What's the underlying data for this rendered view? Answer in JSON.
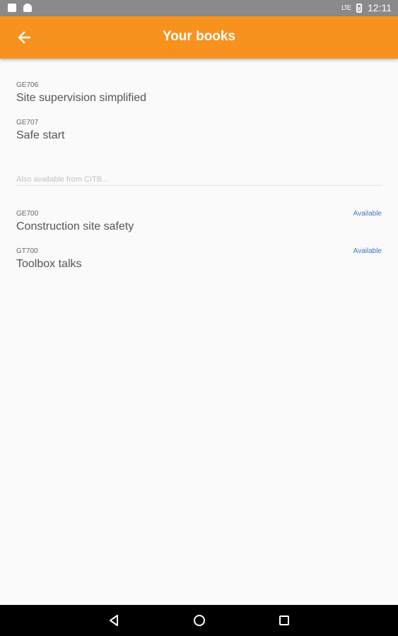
{
  "status_bar": {
    "time": "12:11",
    "network": "LTE",
    "icons": [
      "sd-card-icon",
      "android-icon",
      "signal-icon",
      "battery-icon"
    ]
  },
  "header": {
    "title": "Your books",
    "back_icon": "arrow-left-icon",
    "color": "#f7921e"
  },
  "owned_books": [
    {
      "code": "GE706",
      "name": "Site supervision simplified"
    },
    {
      "code": "GE707",
      "name": "Safe start"
    }
  ],
  "section_hint": "Also available from CITB...",
  "available_books": [
    {
      "code": "GE700",
      "name": "Construction site safety",
      "status": "Available"
    },
    {
      "code": "GT700",
      "name": "Toolbox talks",
      "status": "Available"
    }
  ],
  "nav_bar": {
    "icons": [
      "back-triangle-icon",
      "home-circle-icon",
      "recents-square-icon"
    ]
  }
}
